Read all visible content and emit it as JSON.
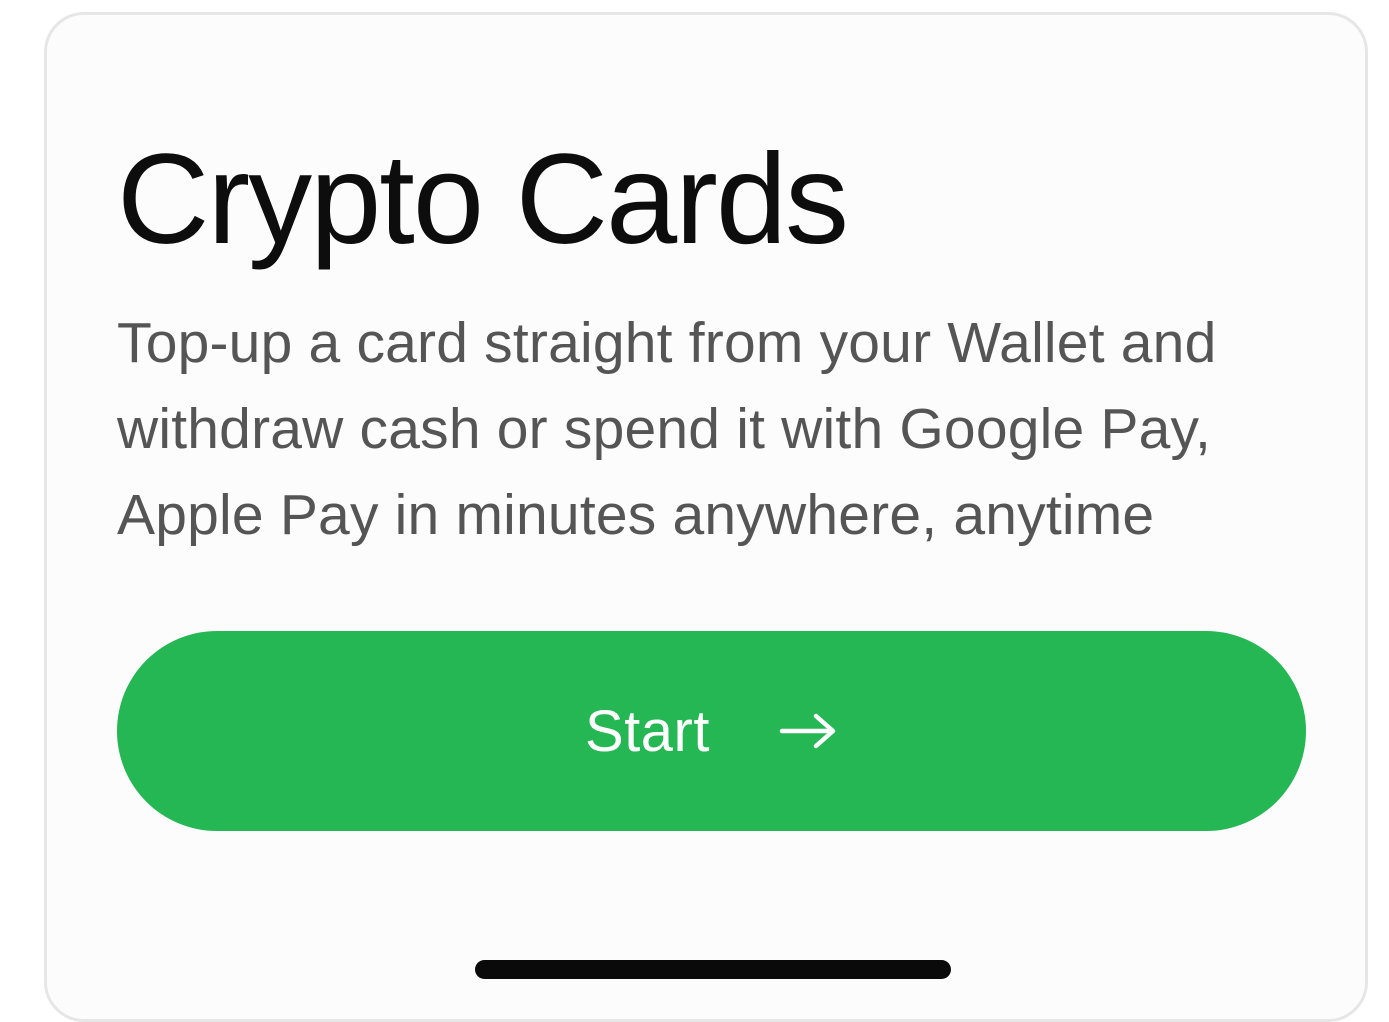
{
  "card": {
    "title": "Crypto Cards",
    "description": "Top-up a card straight from your Wallet and withdraw cash or spend it with Google Pay, Apple Pay in minutes anywhere, anytime",
    "start_button": {
      "label": "Start",
      "icon": "arrow-right-icon"
    }
  },
  "colors": {
    "accent": "#24b754",
    "title": "#0d0d0d",
    "body_text": "#555555",
    "card_border": "#e6e6e6"
  }
}
